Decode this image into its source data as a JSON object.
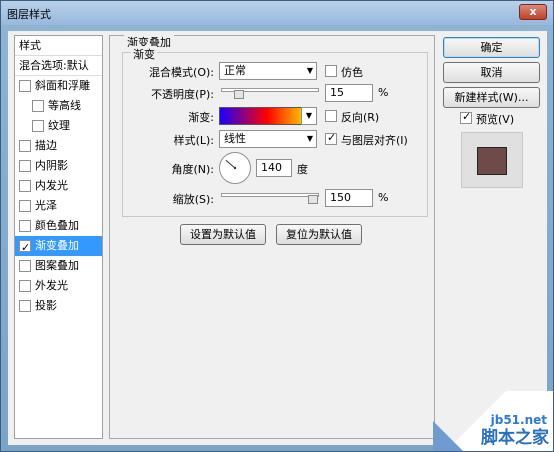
{
  "window": {
    "title": "图层样式",
    "close_glyph": "x"
  },
  "sidebar": {
    "header": "样式",
    "blend_options": "混合选项:默认",
    "items": [
      {
        "label": "斜面和浮雕",
        "checked": false,
        "indent": false
      },
      {
        "label": "等高线",
        "checked": false,
        "indent": true
      },
      {
        "label": "纹理",
        "checked": false,
        "indent": true
      },
      {
        "label": "描边",
        "checked": false,
        "indent": false
      },
      {
        "label": "内阴影",
        "checked": false,
        "indent": false
      },
      {
        "label": "内发光",
        "checked": false,
        "indent": false
      },
      {
        "label": "光泽",
        "checked": false,
        "indent": false
      },
      {
        "label": "颜色叠加",
        "checked": false,
        "indent": false
      },
      {
        "label": "渐变叠加",
        "checked": true,
        "indent": false,
        "selected": true
      },
      {
        "label": "图案叠加",
        "checked": false,
        "indent": false
      },
      {
        "label": "外发光",
        "checked": false,
        "indent": false
      },
      {
        "label": "投影",
        "checked": false,
        "indent": false
      }
    ]
  },
  "panel": {
    "section_title": "渐变叠加",
    "group_title": "渐变",
    "blend_mode_label": "混合模式(O):",
    "blend_mode_value": "正常",
    "dither_label": "仿色",
    "dither_checked": false,
    "opacity_label": "不透明度(P):",
    "opacity_value": "15",
    "opacity_percent": 15,
    "opacity_unit": "%",
    "gradient_label": "渐变:",
    "reverse_label": "反向(R)",
    "reverse_checked": false,
    "style_label": "样式(L):",
    "style_value": "线性",
    "align_label": "与图层对齐(I)",
    "align_checked": true,
    "angle_label": "角度(N):",
    "angle_value": "140",
    "angle_deg": 140,
    "angle_unit": "度",
    "scale_label": "缩放(S):",
    "scale_value": "150",
    "scale_percent": 150,
    "scale_unit": "%",
    "set_default_button": "设置为默认值",
    "reset_default_button": "复位为默认值"
  },
  "actions": {
    "ok": "确定",
    "cancel": "取消",
    "new_style": "新建样式(W)...",
    "preview_label": "预览(V)",
    "preview_checked": true
  },
  "watermark": {
    "site": "jb51.net",
    "name": "脚本之家"
  },
  "colors": {
    "selection": "#3399ff",
    "preview_swatch": "#6e4a48",
    "gradient_stops": [
      "#1a00ff",
      "#ff0000",
      "#ffff00"
    ]
  }
}
